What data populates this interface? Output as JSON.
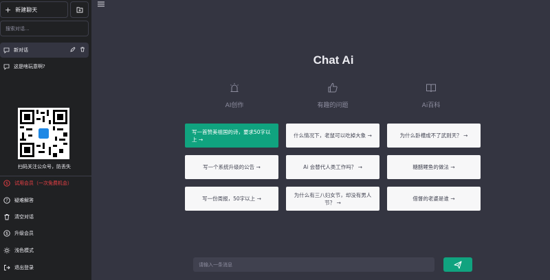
{
  "sidebar": {
    "new_chat": "新建聊天",
    "search_placeholder": "搜索对话...",
    "conversations": [
      {
        "title": "新对话",
        "active": true
      },
      {
        "title": "这是啥玩意啊?",
        "active": false
      }
    ],
    "qr_caption": "扫码关注公众号，防丢失",
    "menu": [
      {
        "label": "试用会员（一次免费机会）",
        "icon": "dollar-circle-icon"
      },
      {
        "label": "疑难解答",
        "icon": "question-circle-icon"
      },
      {
        "label": "清空对话",
        "icon": "trash-icon"
      },
      {
        "label": "升级会员",
        "icon": "dollar-circle-icon"
      },
      {
        "label": "浅色模式",
        "icon": "sun-icon"
      },
      {
        "label": "退出登录",
        "icon": "logout-icon"
      }
    ]
  },
  "main": {
    "title": "Chat Ai",
    "categories": [
      {
        "label": "AI创作",
        "icon": "alarm-light-icon"
      },
      {
        "label": "有趣的问题",
        "icon": "thumbs-up-icon"
      },
      {
        "label": "Ai百科",
        "icon": "book-icon"
      }
    ],
    "prompts": [
      [
        "写一首赞美祖国的诗，要求50字以上 →",
        "什么情况下，老鼠可以吃掉大象 →",
        "为什么卧槽成不了武则天？ →"
      ],
      [
        "写一个系统升级的公告 →",
        "Ai 会替代人类工作吗？ →",
        "糖醋鲤鱼的做法 →"
      ],
      [
        "写一份周报，50字以上 →",
        "为什么有三八妇女节，却没有男人节？ →",
        "借督的老婆是谁 →"
      ]
    ],
    "input_placeholder": "请输入一条消息"
  },
  "colors": {
    "accent": "#10a37f",
    "sidebar": "#202123",
    "main": "#343541",
    "promo": "#ef4146"
  }
}
